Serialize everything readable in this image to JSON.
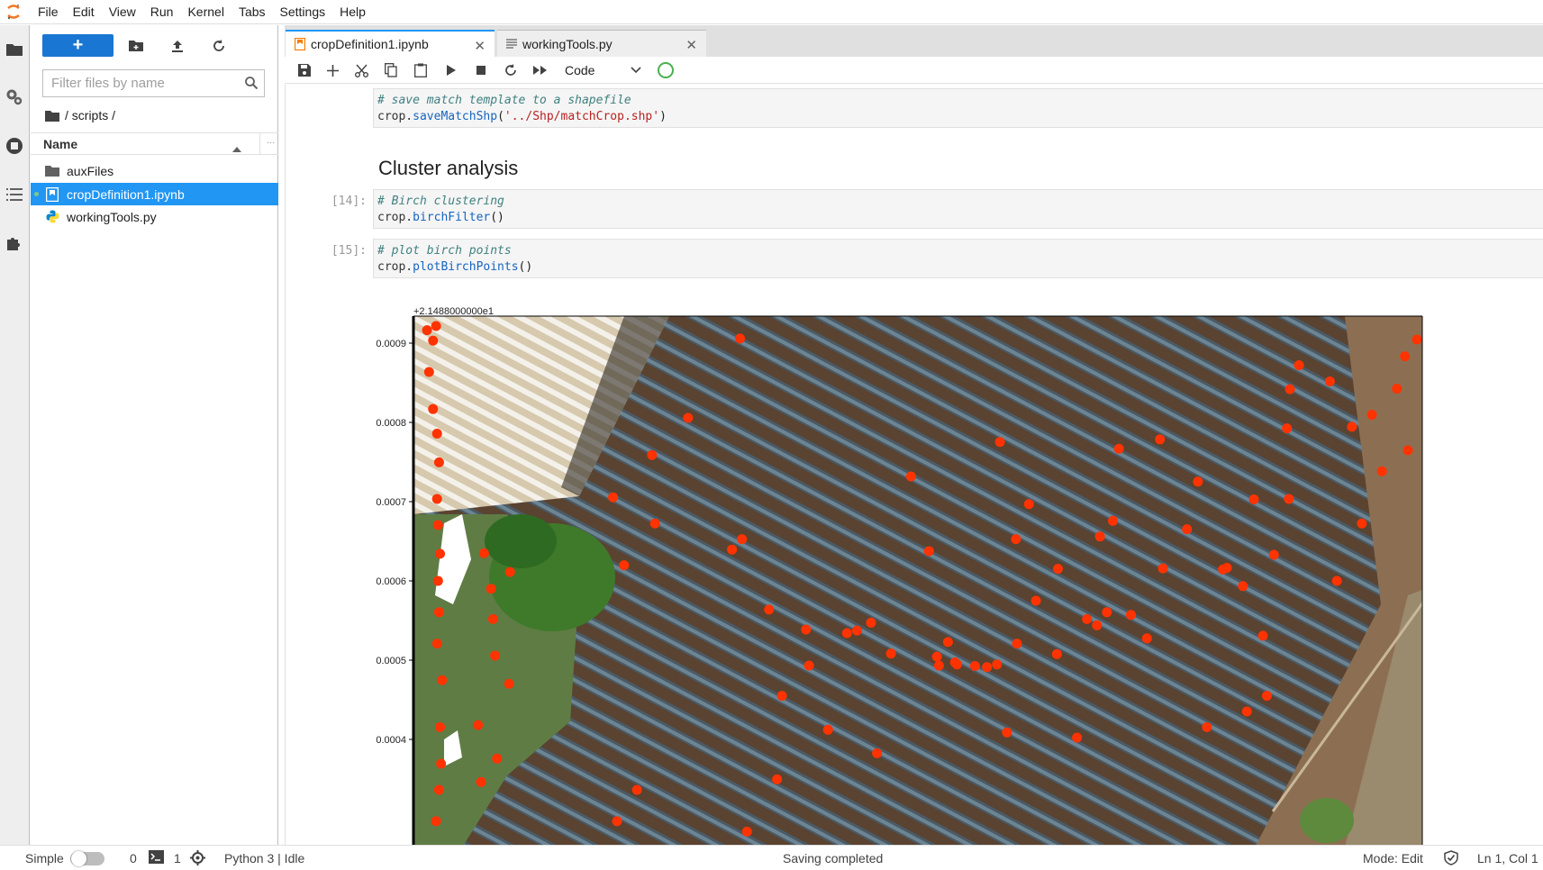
{
  "menu": [
    "File",
    "Edit",
    "View",
    "Run",
    "Kernel",
    "Tabs",
    "Settings",
    "Help"
  ],
  "filebrowser": {
    "filter_placeholder": "Filter files by name",
    "breadcrumb": "/ scripts /",
    "column_name": "Name",
    "files": [
      {
        "name": "auxFiles",
        "type": "folder"
      },
      {
        "name": "cropDefinition1.ipynb",
        "type": "notebook",
        "selected": true,
        "running": true
      },
      {
        "name": "workingTools.py",
        "type": "python"
      }
    ]
  },
  "tabs": [
    {
      "label": "cropDefinition1.ipynb",
      "icon": "notebook-icon",
      "active": true
    },
    {
      "label": "workingTools.py",
      "icon": "text-file-icon",
      "active": false
    }
  ],
  "toolbar": {
    "cell_type": "Code"
  },
  "cells": {
    "cell1": {
      "comment": "# save match template to a shapefile",
      "obj": "crop.",
      "method": "saveMatchShp",
      "arg": "'../Shp/matchCrop.shp'"
    },
    "heading": "Cluster analysis",
    "cell2": {
      "prompt": "[14]:",
      "comment": "# Birch clustering",
      "obj": "crop.",
      "method": "birchFilter",
      "tail": "()"
    },
    "cell3": {
      "prompt": "[15]:",
      "comment": "# plot birch points",
      "obj": "crop.",
      "method": "plotBirchPoints",
      "tail": "()"
    }
  },
  "chart_data": {
    "type": "scatter",
    "offset_label": "+2.1488000000e1",
    "yticks": [
      "0.0009",
      "0.0008",
      "0.0007",
      "0.0006",
      "0.0005",
      "0.0004"
    ],
    "marker_color": "#ff3300",
    "background": "aerial orthophoto of agave crop rows",
    "points": [
      [
        0.019,
        0.012
      ],
      [
        0.016,
        0.04
      ],
      [
        0.012,
        0.1
      ],
      [
        0.016,
        0.171
      ],
      [
        0.02,
        0.218
      ],
      [
        0.022,
        0.273
      ],
      [
        0.02,
        0.343
      ],
      [
        0.021,
        0.393
      ],
      [
        0.023,
        0.448
      ],
      [
        0.021,
        0.5
      ],
      [
        0.022,
        0.56
      ],
      [
        0.02,
        0.62
      ],
      [
        0.025,
        0.69
      ],
      [
        0.023,
        0.78
      ],
      [
        0.024,
        0.85
      ],
      [
        0.022,
        0.9
      ],
      [
        0.019,
        0.96
      ],
      [
        0.067,
        0.447
      ],
      [
        0.074,
        0.515
      ],
      [
        0.076,
        0.573
      ],
      [
        0.093,
        0.483
      ],
      [
        0.078,
        0.643
      ],
      [
        0.061,
        0.776
      ],
      [
        0.064,
        0.885
      ],
      [
        0.092,
        0.697
      ],
      [
        0.196,
        0.34
      ],
      [
        0.207,
        0.47
      ],
      [
        0.235,
        0.259
      ],
      [
        0.238,
        0.39
      ],
      [
        0.271,
        0.188
      ],
      [
        0.315,
        0.44
      ],
      [
        0.323,
        0.036
      ],
      [
        0.325,
        0.42
      ],
      [
        0.352,
        0.555
      ],
      [
        0.365,
        0.72
      ],
      [
        0.389,
        0.593
      ],
      [
        0.392,
        0.662
      ],
      [
        0.411,
        0.785
      ],
      [
        0.454,
        0.58
      ],
      [
        0.474,
        0.639
      ],
      [
        0.494,
        0.3
      ],
      [
        0.512,
        0.443
      ],
      [
        0.522,
        0.662
      ],
      [
        0.531,
        0.617
      ],
      [
        0.538,
        0.656
      ],
      [
        0.558,
        0.663
      ],
      [
        0.583,
        0.234
      ],
      [
        0.599,
        0.42
      ],
      [
        0.612,
        0.353
      ],
      [
        0.619,
        0.538
      ],
      [
        0.641,
        0.477
      ],
      [
        0.67,
        0.573
      ],
      [
        0.683,
        0.415
      ],
      [
        0.696,
        0.385
      ],
      [
        0.702,
        0.247
      ],
      [
        0.714,
        0.565
      ],
      [
        0.743,
        0.229
      ],
      [
        0.746,
        0.476
      ],
      [
        0.77,
        0.401
      ],
      [
        0.781,
        0.31
      ],
      [
        0.806,
        0.478
      ],
      [
        0.826,
        0.51
      ],
      [
        0.837,
        0.344
      ],
      [
        0.846,
        0.605
      ],
      [
        0.857,
        0.45
      ],
      [
        0.872,
        0.343
      ],
      [
        0.882,
        0.087
      ],
      [
        0.87,
        0.208
      ],
      [
        0.873,
        0.133
      ],
      [
        0.913,
        0.118
      ],
      [
        0.935,
        0.205
      ],
      [
        0.955,
        0.182
      ],
      [
        0.965,
        0.29
      ],
      [
        0.991,
        0.25
      ],
      [
        0.98,
        0.132
      ],
      [
        0.988,
        0.07
      ],
      [
        1.0,
        0.038
      ],
      [
        0.54,
        0.66
      ],
      [
        0.52,
        0.645
      ],
      [
        0.43,
        0.6
      ],
      [
        0.44,
        0.595
      ],
      [
        0.57,
        0.665
      ],
      [
        0.58,
        0.66
      ],
      [
        0.6,
        0.62
      ],
      [
        0.68,
        0.585
      ],
      [
        0.69,
        0.56
      ],
      [
        0.73,
        0.61
      ],
      [
        0.81,
        0.475
      ],
      [
        0.64,
        0.64
      ],
      [
        0.945,
        0.39
      ],
      [
        0.92,
        0.5
      ],
      [
        0.85,
        0.72
      ],
      [
        0.83,
        0.75
      ],
      [
        0.79,
        0.78
      ],
      [
        0.66,
        0.8
      ],
      [
        0.59,
        0.79
      ],
      [
        0.46,
        0.83
      ],
      [
        0.36,
        0.88
      ],
      [
        0.22,
        0.9
      ],
      [
        0.2,
        0.96
      ],
      [
        0.08,
        0.84
      ],
      [
        0.33,
        0.98
      ],
      [
        0.01,
        0.02
      ]
    ]
  },
  "statusbar": {
    "mode_label": "Simple",
    "terminals": "0",
    "kernels": "1",
    "kernel": "Python 3 | Idle",
    "message": "Saving completed",
    "mode": "Mode: Edit",
    "position": "Ln 1, Col 1"
  }
}
